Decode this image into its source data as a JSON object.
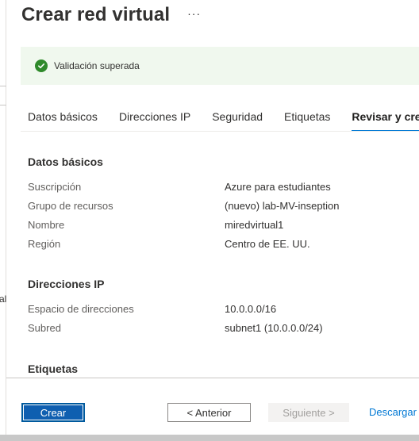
{
  "left_fragment": {
    "text": "al"
  },
  "header": {
    "title": "Crear red virtual",
    "more_label": "···"
  },
  "validation": {
    "text": "Validación superada",
    "status_color": "#2f8a2b"
  },
  "tabs": [
    {
      "label": "Datos básicos"
    },
    {
      "label": "Direcciones IP"
    },
    {
      "label": "Seguridad"
    },
    {
      "label": "Etiquetas"
    },
    {
      "label": "Revisar y crear",
      "active": true
    }
  ],
  "sections": {
    "basics": {
      "title": "Datos básicos",
      "rows": [
        {
          "label": "Suscripción",
          "value": "Azure para estudiantes"
        },
        {
          "label": "Grupo de recursos",
          "value": "(nuevo) lab-MV-inseption"
        },
        {
          "label": "Nombre",
          "value": "miredvirtual1"
        },
        {
          "label": "Región",
          "value": "Centro de EE. UU."
        }
      ]
    },
    "ip": {
      "title": "Direcciones IP",
      "rows": [
        {
          "label": "Espacio de direcciones",
          "value": "10.0.0.0/16"
        },
        {
          "label": "Subred",
          "value": "subnet1 (10.0.0.0/24)"
        }
      ]
    },
    "tags": {
      "title": "Etiquetas"
    }
  },
  "footer": {
    "create_label": "Crear",
    "previous_label": "< Anterior",
    "next_label": "Siguiente >",
    "download_label": "Descargar"
  },
  "colors": {
    "accent": "#0078d4",
    "primary_button": "#0f5fb0",
    "banner_bg": "#f0f8ee"
  }
}
